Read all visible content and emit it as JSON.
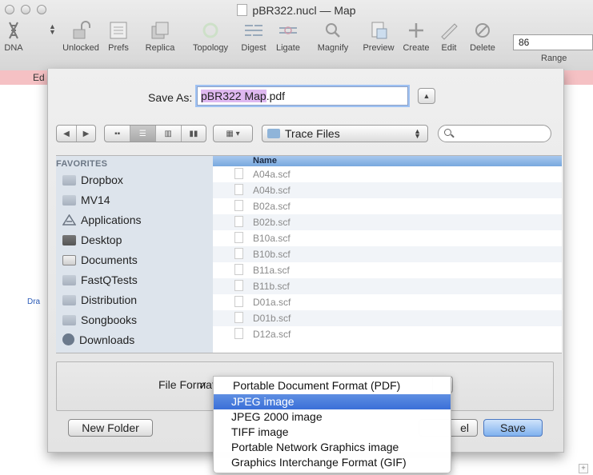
{
  "window": {
    "title": "pBR322.nucl — Map"
  },
  "toolbar": {
    "items": [
      {
        "label": "DNA",
        "icon": "dna-icon"
      },
      {
        "label": "Unlocked",
        "icon": "unlocked-icon"
      },
      {
        "label": "Prefs",
        "icon": "prefs-icon"
      },
      {
        "label": "Replica",
        "icon": "replica-icon"
      },
      {
        "label": "Topology",
        "icon": "topology-icon"
      },
      {
        "label": "Digest",
        "icon": "digest-icon"
      },
      {
        "label": "Ligate",
        "icon": "ligate-icon"
      },
      {
        "label": "Magnify",
        "icon": "magnify-icon"
      },
      {
        "label": "Preview",
        "icon": "preview-icon"
      },
      {
        "label": "Create",
        "icon": "create-icon"
      },
      {
        "label": "Edit",
        "icon": "edit-icon"
      },
      {
        "label": "Delete",
        "icon": "delete-icon"
      }
    ],
    "range_value": "86",
    "range_label": "Range"
  },
  "pinkbar": {
    "label": "Ed"
  },
  "side_label": "Dra",
  "save_sheet": {
    "save_as_label": "Save As:",
    "filename_highlight": "pBR322 Map",
    "filename_rest": ".pdf",
    "location": "Trace Files",
    "favorites_header": "FAVORITES",
    "favorites": [
      "Dropbox",
      "MV14",
      "Applications",
      "Desktop",
      "Documents",
      "FastQTests",
      "Distribution",
      "Songbooks",
      "Downloads"
    ],
    "column_header": "Name",
    "files": [
      "A04a.scf",
      "A04b.scf",
      "B02a.scf",
      "B02b.scf",
      "B10a.scf",
      "B10b.scf",
      "B11a.scf",
      "B11b.scf",
      "D01a.scf",
      "D01b.scf",
      "D12a.scf"
    ],
    "file_format_label": "File Format",
    "new_folder_label": "New Folder",
    "cancel_label": "el",
    "save_label": "Save"
  },
  "format_menu": {
    "selected": "Portable Document Format (PDF)",
    "highlighted": "JPEG image",
    "options": [
      "Portable Document Format (PDF)",
      "JPEG image",
      "JPEG 2000 image",
      "TIFF image",
      "Portable Network Graphics image",
      "Graphics Interchange Format (GIF)"
    ],
    "check_mark": "✓"
  },
  "colors": {
    "pink_bar": "#f5c1c4",
    "selection_blue": "#3a6fd8",
    "filename_highlight": "#dfb8f0"
  }
}
